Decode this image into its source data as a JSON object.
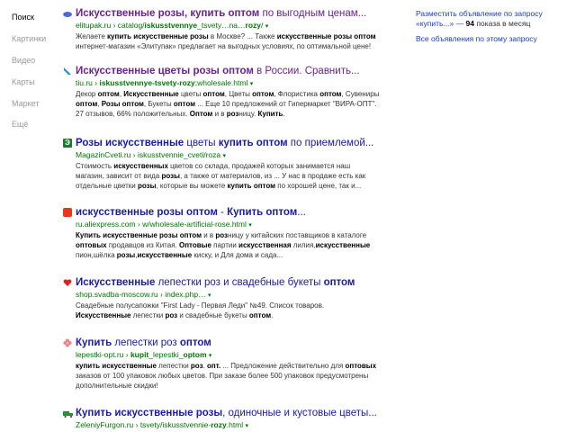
{
  "nav": [
    {
      "label": "Поиск",
      "active": true
    },
    {
      "label": "Картинки",
      "active": false
    },
    {
      "label": "Видео",
      "active": false
    },
    {
      "label": "Карты",
      "active": false
    },
    {
      "label": "Маркет",
      "active": false
    },
    {
      "label": "Ещё",
      "active": false
    }
  ],
  "results": [
    {
      "title_b1": "Искусственные розы, купить оптом",
      "title_n1": " по выгодным ценам...",
      "url_host": "elitupak.ru",
      "url_path1": " › catalog/",
      "url_bold1": "iskusstvennye",
      "url_path2": "_tsvety…na…",
      "url_bold2": "rozy",
      "url_path3": "/",
      "snip1_a": "Желаете ",
      "snip1_b": "купить искусственные",
      "snip1_c": " ",
      "snip1_d": "розы",
      "snip1_e": " в Москве? ... Также ",
      "snip1_f": "искусственные розы оптом",
      "snip2": "интернет-магазин «Элитупак» предлагает на выгодных условиях, по оптимальной цене!"
    },
    {
      "title_b1": "Искусственные цветы розы оптом",
      "title_n1": " в России. Сравнить...",
      "url_host": "tiu.ru",
      "url_path1": " › ",
      "url_bold1": "iskusstvennye-tsvety-rozy",
      "url_path2": ";wholesale.html",
      "snip1": "Декор оптом, Искусственные цветы оптом, Цветы оптом, Флористика оптом, Сувениры",
      "snip2": "оптом, Розы оптом, Букеты оптом ... Еще 10 предложений от Гипермаркет \"ВИРА-ОПТ\".",
      "snip3": "27 отзывов, 66% положительных. Оптом и в розницу. Купить."
    },
    {
      "title_b1": "Розы искусственные",
      "title_n1": " цветы ",
      "title_b2": "купить оптом",
      "title_n2": " по приемлемой...",
      "url_host": "MagazinCveti.ru",
      "url_path1": " › iskusstvennie_cveti/roza",
      "snip1": "Стоимость искусственных цветов со склада, продажей которых занимается наш",
      "snip2": "магазин, зависит от вида розы, а также от материалов, из ... У нас в продаже есть как",
      "snip3": "отдельные цветки розы, которые вы можете купить оптом по хорошей цене, так и..."
    },
    {
      "title_b1": "искусственные розы оптом",
      "title_n1": " - ",
      "title_b2": "Купить оптом",
      "title_n2": "...",
      "url_host": "ru.aliexpress.com",
      "url_path1": " › w/wholesale-artificial-rose.html",
      "snip1": "Купить искусственные розы оптом и в розницу у китайских поставщиков в каталоге",
      "snip2": "оптовых продавцов из Китая. Оптовые партии искусственная лилия,искусственные",
      "snip3": "пион,шёлка розы,искусственные киску, и Для дома и сада..."
    },
    {
      "title_b1": "Искусственные",
      "title_n1": " лепестки роз и свадебные букеты ",
      "title_b2": "оптом",
      "url_host": "shop.svadba-moscow.ru",
      "url_path1": " › index.php…",
      "snip1": "Свадебные полусапожки \"First Lady - Первая Леди\" №49. Список товаров.",
      "snip2": "Искусственные лепестки роз и свадебные букеты оптом."
    },
    {
      "title_b1": "Купить",
      "title_n1": " лепестки роз ",
      "title_b2": "оптом",
      "url_host": "lepestki-opt.ru",
      "url_path1": " › ",
      "url_bold1": "kupit",
      "url_path2": "_lepestki_",
      "url_bold2": "optom",
      "snip1": "купить искусственные лепестки роз. опт. ... Предложение действительно для оптовых",
      "snip2": "заказов от 100 упаковок любых цветов. При заказе более 500 упаковок предусмотрены",
      "snip3": "дополнительные скидки!"
    },
    {
      "title_b1": "Купить искусственные розы",
      "title_n1": ", одиночные и кустовые цветы...",
      "url_host": "ZeleniyFurgon.ru",
      "url_path1": " › tsvety/iskusstvennie-",
      "url_bold1": "rozy",
      "url_path2": ".html"
    }
  ],
  "arrow": "▾",
  "sidebar": {
    "ad_line1": "Разместить объявление по запросу",
    "ad_line2a": "«купить...» — ",
    "ad_count": "94",
    "ad_line2b": " показа в месяц",
    "all_ads": "Все объявления по этому запросу"
  },
  "colors": {
    "link": "#1a1aa6",
    "visited": "#6b238e",
    "url": "#007700",
    "nav_inactive": "#999999"
  }
}
